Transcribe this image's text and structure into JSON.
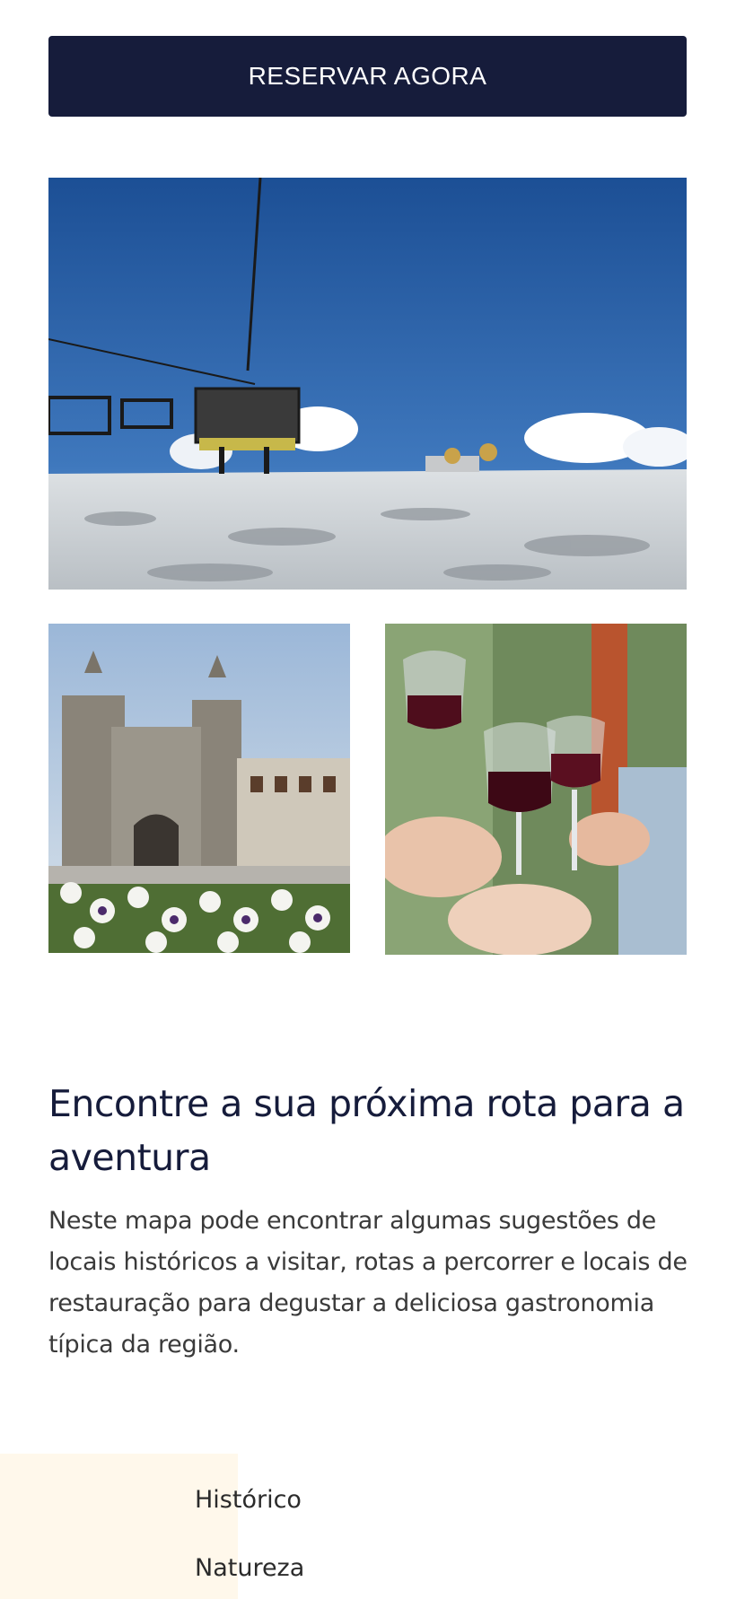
{
  "cta": {
    "label": "RESERVAR AGORA"
  },
  "gallery": {
    "hero": {
      "icon": "ski-lift-snow-photo"
    },
    "left": {
      "icon": "cathedral-photo"
    },
    "right": {
      "icon": "wine-toast-photo"
    }
  },
  "section": {
    "heading": "Encontre a sua próxima rota para a aventura",
    "description": "Neste mapa pode encontrar algumas sugestões de locais históricos a visitar, rotas a percorrer e locais de restauração para degustar a deliciosa gastronomia típica da região."
  },
  "filters": {
    "items": [
      {
        "label": "Histórico"
      },
      {
        "label": "Natureza"
      }
    ]
  },
  "colors": {
    "primary": "#161c3b",
    "panel": "#fff8eb",
    "text": "#3a3a3a"
  }
}
